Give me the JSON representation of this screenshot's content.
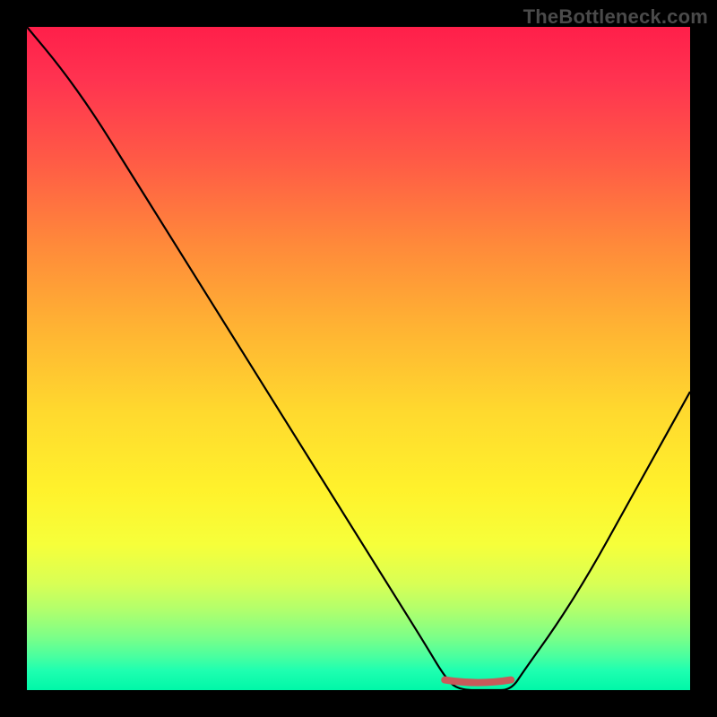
{
  "watermark": "TheBottleneck.com",
  "colors": {
    "page_bg": "#000000",
    "curve": "#000000",
    "marker": "#c85a5a",
    "gradient_top": "#ff1f4a",
    "gradient_mid": "#fff22c",
    "gradient_bottom": "#00f7a8"
  },
  "chart_data": {
    "type": "line",
    "title": "",
    "xlabel": "",
    "ylabel": "",
    "xlim": [
      0,
      100
    ],
    "ylim": [
      0,
      100
    ],
    "grid": false,
    "legend": false,
    "series": [
      {
        "name": "bottleneck-curve",
        "x": [
          0,
          5,
          10,
          15,
          20,
          25,
          30,
          35,
          40,
          45,
          50,
          55,
          60,
          63,
          65,
          70,
          73,
          75,
          80,
          85,
          90,
          95,
          100
        ],
        "values": [
          100,
          94,
          87,
          79,
          71,
          63,
          55,
          47,
          39,
          31,
          23,
          15,
          7,
          2,
          0,
          0,
          0,
          3,
          10,
          18,
          27,
          36,
          45
        ]
      }
    ],
    "annotations": [
      {
        "name": "optimal-range-marker",
        "x_start": 63,
        "x_end": 73,
        "y": 1,
        "color": "#c85a5a"
      }
    ]
  }
}
